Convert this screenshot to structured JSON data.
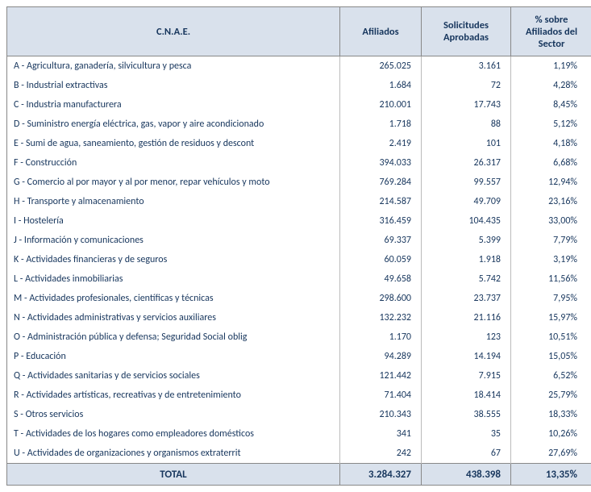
{
  "headers": {
    "cnae": "C.N.A.E.",
    "afiliados": "Afiliados",
    "solicitudes": "Solicitudes Aprobadas",
    "pct": "% sobre Afiliados del Sector"
  },
  "rows": [
    {
      "label": "A - Agricultura, ganadería, silvicultura y pesca",
      "afiliados": "265.025",
      "solic": "3.161",
      "pct": "1,19%"
    },
    {
      "label": "B - Industrial extractivas",
      "afiliados": "1.684",
      "solic": "72",
      "pct": "4,28%"
    },
    {
      "label": "C - Industria manufacturera",
      "afiliados": "210.001",
      "solic": "17.743",
      "pct": "8,45%"
    },
    {
      "label": "D - Suministro energía eléctrica, gas, vapor y aire acondicionado",
      "afiliados": "1.718",
      "solic": "88",
      "pct": "5,12%"
    },
    {
      "label": "E - Sumi de agua, saneamiento, gestión de residuos y descont",
      "afiliados": "2.419",
      "solic": "101",
      "pct": "4,18%"
    },
    {
      "label": "F - Construcción",
      "afiliados": "394.033",
      "solic": "26.317",
      "pct": "6,68%"
    },
    {
      "label": "G - Comercio al por mayor y al por menor, repar vehículos y moto",
      "afiliados": "769.284",
      "solic": "99.557",
      "pct": "12,94%"
    },
    {
      "label": "H - Transporte y almacenamiento",
      "afiliados": "214.587",
      "solic": "49.709",
      "pct": "23,16%"
    },
    {
      "label": "I - Hostelería",
      "afiliados": "316.459",
      "solic": "104.435",
      "pct": "33,00%"
    },
    {
      "label": "J - Información y comunicaciones",
      "afiliados": "69.337",
      "solic": "5.399",
      "pct": "7,79%"
    },
    {
      "label": "K - Actividades financieras y de seguros",
      "afiliados": "60.059",
      "solic": "1.918",
      "pct": "3,19%"
    },
    {
      "label": "L - Actividades inmobiliarias",
      "afiliados": "49.658",
      "solic": "5.742",
      "pct": "11,56%"
    },
    {
      "label": "M - Actividades profesionales, científicas y técnicas",
      "afiliados": "298.600",
      "solic": "23.737",
      "pct": "7,95%"
    },
    {
      "label": "N - Actividades administrativas y servicios auxiliares",
      "afiliados": "132.232",
      "solic": "21.116",
      "pct": "15,97%"
    },
    {
      "label": "O - Administración pública y defensa; Seguridad Social oblig",
      "afiliados": "1.170",
      "solic": "123",
      "pct": "10,51%"
    },
    {
      "label": "P - Educación",
      "afiliados": "94.289",
      "solic": "14.194",
      "pct": "15,05%"
    },
    {
      "label": "Q - Actividades sanitarias y de servicios sociales",
      "afiliados": "121.442",
      "solic": "7.915",
      "pct": "6,52%"
    },
    {
      "label": "R - Actividades artísticas, recreativas y de entretenimiento",
      "afiliados": "71.404",
      "solic": "18.414",
      "pct": "25,79%"
    },
    {
      "label": "S - Otros servicios",
      "afiliados": "210.343",
      "solic": "38.555",
      "pct": "18,33%"
    },
    {
      "label": "T - Actividades de los hogares como empleadores domésticos",
      "afiliados": "341",
      "solic": "35",
      "pct": "10,26%"
    },
    {
      "label": "U - Actividades de organizaciones y organismos extraterrit",
      "afiliados": "242",
      "solic": "67",
      "pct": "27,69%"
    }
  ],
  "total": {
    "label": "TOTAL",
    "afiliados": "3.284.327",
    "solic": "438.398",
    "pct": "13,35%"
  }
}
